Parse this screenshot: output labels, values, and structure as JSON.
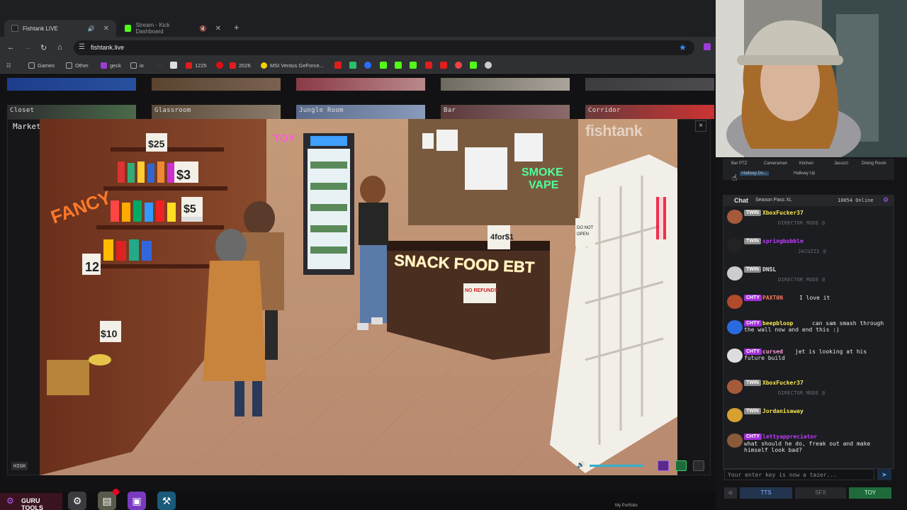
{
  "browser": {
    "tabs": [
      {
        "label": "Fishtank LIVE",
        "active": true
      },
      {
        "label": "Stream - Kick Dashboard",
        "active": false
      }
    ],
    "url": "fishtank.live",
    "bookmarks": [
      {
        "label": "Games"
      },
      {
        "label": "Other"
      },
      {
        "label": "geck"
      },
      {
        "label": "io"
      },
      {
        "label": "1225"
      },
      {
        "label": "2026"
      },
      {
        "label": "MSI Ventus GeForce..."
      }
    ]
  },
  "rooms": {
    "thumbs": [
      "Closet",
      "Glassroom",
      "Jungle Room",
      "Bar",
      "Corridor"
    ],
    "current": "Market"
  },
  "player": {
    "quality": "HIGH",
    "close_label": "×",
    "watermark": "fishtank"
  },
  "dock": {
    "guru_label": "GURU TOOLS",
    "portfolio": "My Portfolio"
  },
  "cam_tabs": [
    "Bar PTZ",
    "Cameraman",
    "Kitchen",
    "Jacuzzi",
    "Dining Room",
    "Hallway Do...",
    "Hallway Up"
  ],
  "chat": {
    "title": "Chat",
    "season": "Season Pass XL",
    "online": "10054 Online",
    "messages": [
      {
        "badge": "TWIN",
        "user": "XboxFucker37",
        "text": "",
        "system": "DIRECTOR MODE @",
        "color": "#f7e84e"
      },
      {
        "badge": "TWIN",
        "user": "springbubble",
        "text": "",
        "system": "JACUZZI @",
        "color": "#c03cff"
      },
      {
        "badge": "TWIN",
        "user": "DNSL",
        "text": "",
        "system": "DIRECTOR MODE @",
        "color": "#e8e8e8"
      },
      {
        "badge": "CHTY",
        "user": "PAXT0N",
        "text": "I love it",
        "system": "",
        "color": "#ff7a5a"
      },
      {
        "badge": "CHTY",
        "user": "beepbloop",
        "text": "can sam smash through the wall now and end this :)",
        "system": "",
        "color": "#f7e84e"
      },
      {
        "badge": "CHTY",
        "user": "cursed",
        "text": "jet is looking at his future build",
        "system": "",
        "color": "#ff9bd8"
      },
      {
        "badge": "TWIN",
        "user": "XboxFucker37",
        "text": "",
        "system": "DIRECTOR MODE @",
        "color": "#f7e84e"
      },
      {
        "badge": "TWIN",
        "user": "Jordanisaway",
        "text": "",
        "system": "",
        "color": "#f7e84e"
      },
      {
        "badge": "CHTY",
        "user": "lettyappreciator",
        "text": "what should he do, freak out and make himself look bad?",
        "system": "",
        "color": "#c03cff"
      }
    ],
    "input_placeholder": "Your enter key is now a tazer...",
    "send_label": "➤",
    "actions": [
      {
        "label": "TTS"
      },
      {
        "label": "SFX"
      },
      {
        "label": "TOY"
      }
    ]
  },
  "colors": {
    "accent_purple": "#b45bff",
    "chaty_badge": "#a12fd8",
    "twin_badge": "#8c8c8c",
    "volume": "#2fb0d0"
  }
}
